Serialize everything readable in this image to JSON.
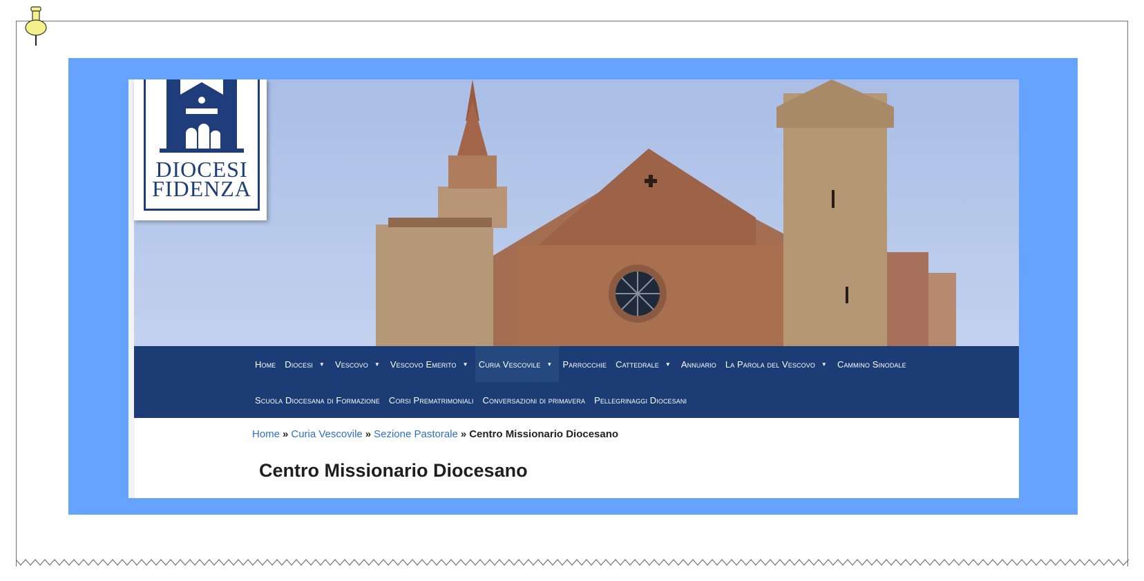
{
  "site": {
    "logo": {
      "line1": "DIOCESI",
      "line2": "FIDENZA"
    }
  },
  "nav": {
    "row1": [
      {
        "label": "Home",
        "has_caret": false,
        "active": false
      },
      {
        "label": "Diocesi",
        "has_caret": true,
        "active": false
      },
      {
        "label": "Vescovo",
        "has_caret": true,
        "active": false
      },
      {
        "label": "Vescovo Emerito",
        "has_caret": true,
        "active": false
      },
      {
        "label": "Curia Vescovile",
        "has_caret": true,
        "active": true
      },
      {
        "label": "Parrocchie",
        "has_caret": false,
        "active": false
      },
      {
        "label": "Cattedrale",
        "has_caret": true,
        "active": false
      },
      {
        "label": "Annuario",
        "has_caret": false,
        "active": false
      },
      {
        "label": "La Parola del Vescovo",
        "has_caret": true,
        "active": false
      },
      {
        "label": "Cammino Sinodale",
        "has_caret": false,
        "active": false
      }
    ],
    "row2": [
      {
        "label": "Scuola Diocesana di Formazione",
        "has_caret": false,
        "active": false
      },
      {
        "label": "Corsi Prematrimoniali",
        "has_caret": false,
        "active": false
      },
      {
        "label": "Conversazioni di primavera",
        "has_caret": false,
        "active": false
      },
      {
        "label": "Pellegrinaggi Diocesani",
        "has_caret": false,
        "active": false
      }
    ],
    "caret_glyph": "▼"
  },
  "breadcrumb": {
    "items": [
      "Home",
      "Curia Vescovile",
      "Sezione Pastorale"
    ],
    "current": "Centro Missionario Diocesano",
    "separator": "»"
  },
  "page": {
    "title": "Centro Missionario Diocesano"
  },
  "colors": {
    "highlight_frame": "#66a3ff",
    "nav_bg": "#1c3c75",
    "nav_active": "#25497f",
    "link": "#2d6fcf",
    "logo_blue": "#1f3d7a"
  }
}
